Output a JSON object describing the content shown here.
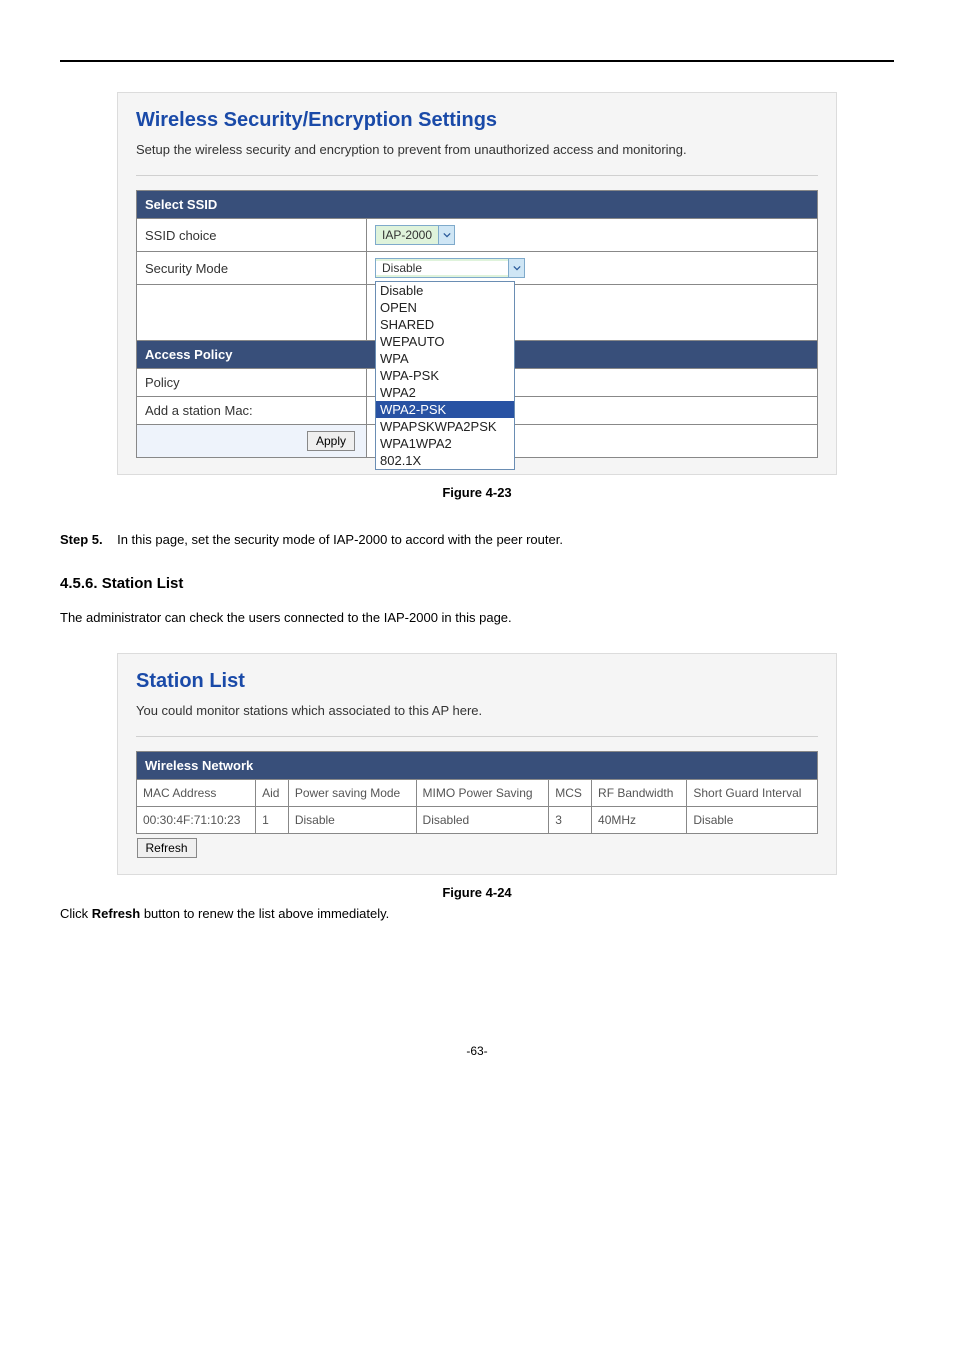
{
  "panel1": {
    "title": "Wireless Security/Encryption Settings",
    "desc": "Setup the wireless security and encryption to prevent from unauthorized access and monitoring.",
    "select_ssid_header": "Select SSID",
    "ssid_choice_label": "SSID choice",
    "ssid_choice_value": "IAP-2000",
    "security_mode_label": "Security Mode",
    "security_mode_value": "Disable",
    "security_mode_options": [
      "Disable",
      "OPEN",
      "SHARED",
      "WEPAUTO",
      "WPA",
      "WPA-PSK",
      "WPA2",
      "WPA2-PSK",
      "WPAPSKWPA2PSK",
      "WPA1WPA2",
      "802.1X"
    ],
    "highlighted_option_index": 7,
    "access_policy_header": "Access Policy",
    "policy_label": "Policy",
    "add_station_label": "Add a station Mac:",
    "apply_button": "Apply"
  },
  "figure1_caption": "Figure 4-23",
  "step5": {
    "label": "Step 5.",
    "text": "In this page, set the security mode of IAP-2000 to accord with the peer router."
  },
  "heading": "4.5.6.  Station List",
  "intro": "The administrator can check the users connected to the IAP-2000 in this page.",
  "panel2": {
    "title": "Station List",
    "desc": "You could monitor stations which associated to this AP here.",
    "wireless_header": "Wireless Network",
    "cols": [
      "MAC Address",
      "Aid",
      "Power saving Mode",
      "MIMO Power Saving",
      "MCS",
      "RF Bandwidth",
      "Short Guard Interval"
    ],
    "row": [
      "00:30:4F:71:10:23",
      "1",
      "Disable",
      "Disabled",
      "3",
      "40MHz",
      "Disable"
    ],
    "refresh": "Refresh"
  },
  "figure2_caption": "Figure 4-24",
  "after_figure2_pre": "Click ",
  "after_figure2_bold": "Refresh",
  "after_figure2_post": " button to renew the list above immediately.",
  "page_number": "-63-"
}
